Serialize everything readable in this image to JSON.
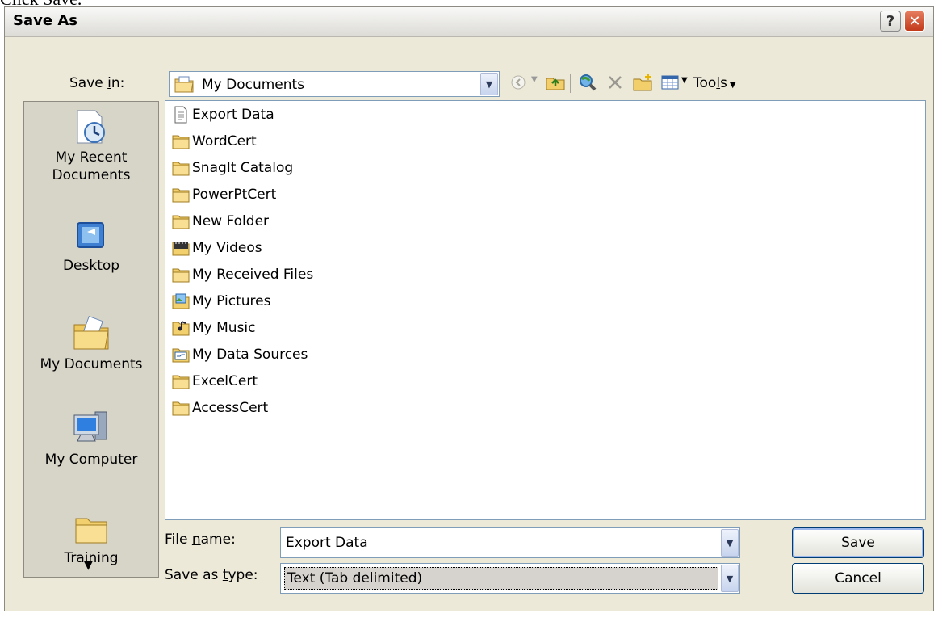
{
  "caption": "Click Save.",
  "window": {
    "title": "Save As",
    "help_label": "?",
    "close_label": "✕"
  },
  "save_in": {
    "label_pre": "Save ",
    "label_key": "i",
    "label_post": "n:",
    "value": "My Documents"
  },
  "toolbar": {
    "tools_pre": "Too",
    "tools_key": "l",
    "tools_post": "s",
    "icons": [
      "back-icon",
      "up-folder-icon",
      "search-web-icon",
      "delete-icon",
      "new-folder-icon",
      "views-icon"
    ]
  },
  "places": [
    {
      "label": "My Recent\nDocuments",
      "icon": "recent-documents-icon"
    },
    {
      "label": "Desktop",
      "icon": "desktop-icon"
    },
    {
      "label": "My Documents",
      "icon": "my-documents-icon"
    },
    {
      "label": "My Computer",
      "icon": "my-computer-icon"
    },
    {
      "label": "Training",
      "icon": "folder-icon"
    }
  ],
  "files": [
    {
      "name": "Export Data",
      "icon": "text-file-icon"
    },
    {
      "name": "WordCert",
      "icon": "folder-icon"
    },
    {
      "name": "SnagIt Catalog",
      "icon": "folder-icon"
    },
    {
      "name": "PowerPtCert",
      "icon": "folder-icon"
    },
    {
      "name": "New Folder",
      "icon": "folder-icon"
    },
    {
      "name": "My Videos",
      "icon": "videos-folder-icon"
    },
    {
      "name": "My Received Files",
      "icon": "folder-icon"
    },
    {
      "name": "My Pictures",
      "icon": "pictures-folder-icon"
    },
    {
      "name": "My Music",
      "icon": "music-folder-icon"
    },
    {
      "name": "My Data Sources",
      "icon": "data-sources-folder-icon"
    },
    {
      "name": "ExcelCert",
      "icon": "folder-icon"
    },
    {
      "name": "AccessCert",
      "icon": "folder-icon"
    }
  ],
  "file_name": {
    "label_pre": "File ",
    "label_key": "n",
    "label_post": "ame:",
    "value": "Export Data"
  },
  "save_as_type": {
    "label_pre": "Save as ",
    "label_key": "t",
    "label_post": "ype:",
    "value": "Text (Tab delimited)"
  },
  "buttons": {
    "save_key": "S",
    "save_rest": "ave",
    "cancel_label": "Cancel"
  },
  "colors": {
    "face": "#ece9d8",
    "places_bg": "#d7d4c8",
    "border": "#7f9db9",
    "close": "#c23a1b"
  }
}
